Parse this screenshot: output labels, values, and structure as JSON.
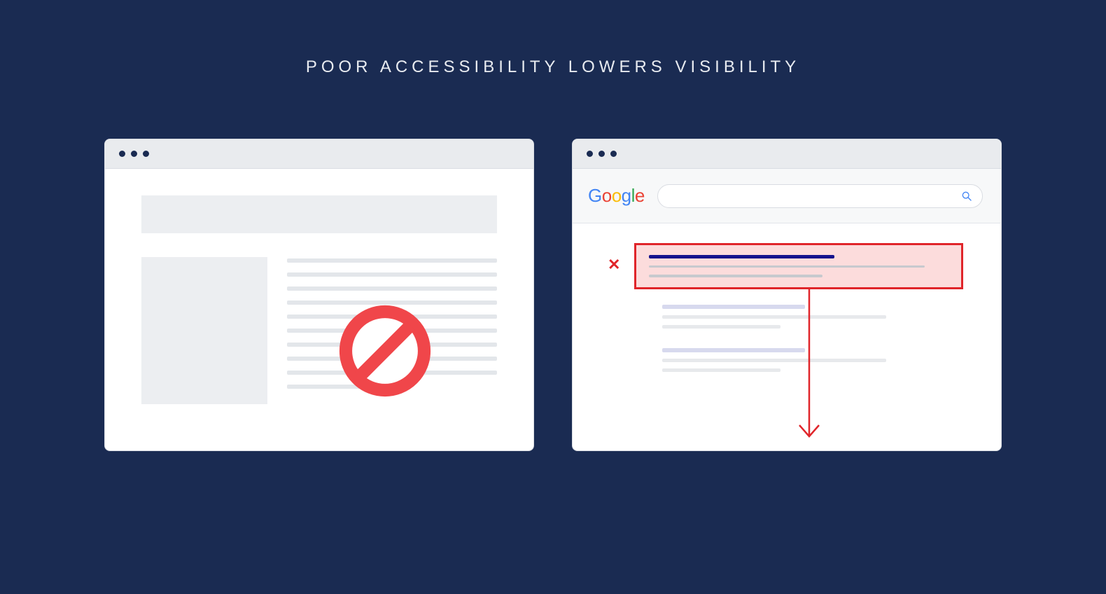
{
  "title": "POOR ACCESSIBILITY LOWERS VISIBILITY",
  "left_panel": {
    "description": "inaccessible-website-mockup",
    "icon": "prohibited"
  },
  "right_panel": {
    "logo": "Google",
    "search_placeholder": "",
    "rejected_marker": "✕",
    "action": "ranking-drops"
  },
  "colors": {
    "background": "#1a2b52",
    "danger": "#e0252a",
    "link": "#14138d"
  }
}
